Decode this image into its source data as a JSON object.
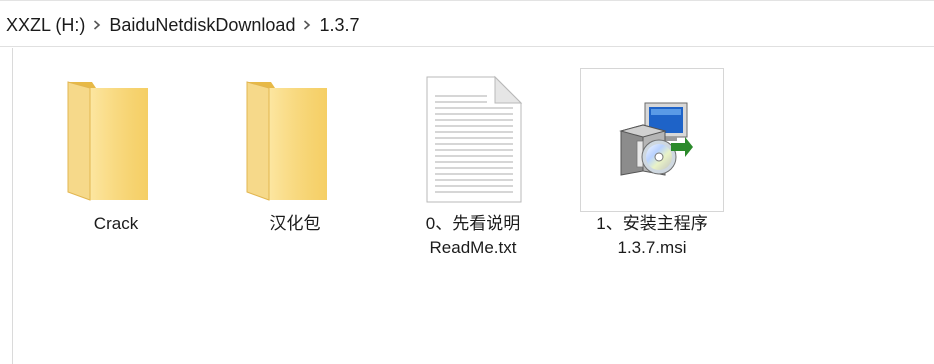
{
  "breadcrumb": {
    "items": [
      "XXZL (H:)",
      "BaiduNetdiskDownload",
      "1.3.7"
    ]
  },
  "files": [
    {
      "name": "Crack",
      "icon": "folder-icon",
      "type": "folder"
    },
    {
      "name": "汉化包",
      "icon": "folder-icon",
      "type": "folder"
    },
    {
      "line1": "0、先看说明",
      "line2": "ReadMe.txt",
      "icon": "text-file-icon",
      "type": "file"
    },
    {
      "line1": "1、安装主程序",
      "line2": "1.3.7.msi",
      "icon": "installer-icon",
      "type": "file",
      "selected": true
    }
  ]
}
